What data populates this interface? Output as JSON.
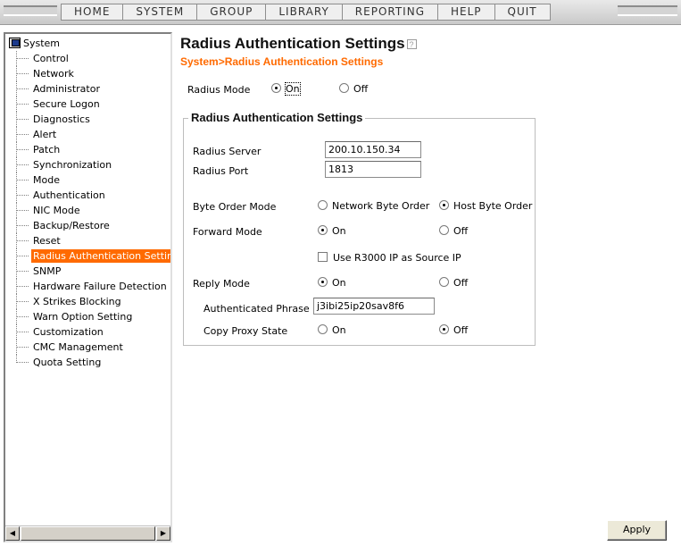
{
  "menu": {
    "items": [
      "HOME",
      "SYSTEM",
      "GROUP",
      "LIBRARY",
      "REPORTING",
      "HELP",
      "QUIT"
    ]
  },
  "sidebar": {
    "root_label": "System",
    "items": [
      "Control",
      "Network",
      "Administrator",
      "Secure Logon",
      "Diagnostics",
      "Alert",
      "Patch",
      "Synchronization",
      "Mode",
      "Authentication",
      "NIC Mode",
      "Backup/Restore",
      "Reset",
      "Radius Authentication Setting",
      "SNMP",
      "Hardware Failure Detection",
      "X Strikes Blocking",
      "Warn Option Setting",
      "Customization",
      "CMC Management",
      "Quota Setting"
    ],
    "selected": "Radius Authentication Setting"
  },
  "main": {
    "title": "Radius Authentication Settings",
    "breadcrumb": "System>Radius Authentication Settings",
    "radius_mode": {
      "label": "Radius Mode",
      "on": "On",
      "off": "Off",
      "value": "On"
    },
    "group_title": "Radius Authentication Settings",
    "radius_server": {
      "label": "Radius Server",
      "value": "200.10.150.34"
    },
    "radius_port": {
      "label": "Radius Port",
      "value": "1813"
    },
    "byte_order": {
      "label": "Byte Order Mode",
      "network": "Network Byte Order",
      "host": "Host Byte Order",
      "value": "Host Byte Order"
    },
    "forward_mode": {
      "label": "Forward Mode",
      "on": "On",
      "off": "Off",
      "value": "On"
    },
    "use_source_ip": {
      "label": "Use R3000 IP as Source IP",
      "checked": false
    },
    "reply_mode": {
      "label": "Reply Mode",
      "on": "On",
      "off": "Off",
      "value": "On"
    },
    "auth_phrase": {
      "label": "Authenticated Phrase",
      "value": "j3ibi25ip20sav8f6"
    },
    "copy_proxy": {
      "label": "Copy Proxy State",
      "on": "On",
      "off": "Off",
      "value": "Off"
    },
    "apply_label": "Apply"
  }
}
